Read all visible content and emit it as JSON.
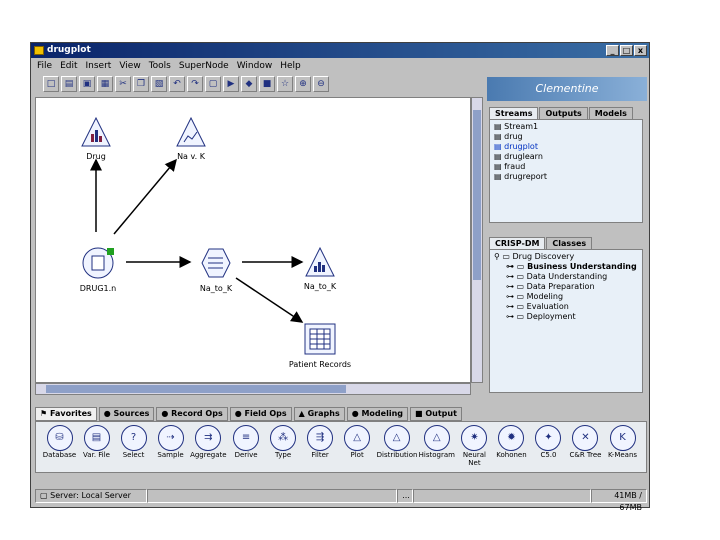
{
  "window": {
    "title": "drugplot",
    "min": "_",
    "max": "□",
    "close": "x"
  },
  "menu": [
    "File",
    "Edit",
    "Insert",
    "View",
    "Tools",
    "SuperNode",
    "Window",
    "Help"
  ],
  "nodes": {
    "drug": "Drug",
    "navk1": "Na v. K",
    "drug1n": "DRUG1.n",
    "na_to_k_derive": "Na_to_K",
    "na_to_k_hist": "Na_to_K",
    "patient_records": "Patient Records"
  },
  "right": {
    "brand": "Clementine",
    "tabs": [
      "Streams",
      "Outputs",
      "Models"
    ],
    "streams": [
      "Stream1",
      "drug",
      "drugplot",
      "druglearn",
      "fraud",
      "drugreport"
    ],
    "project_tabs": [
      "CRISP-DM",
      "Classes"
    ],
    "project": {
      "root": "Drug Discovery",
      "phases": [
        "Business Understanding",
        "Data Understanding",
        "Data Preparation",
        "Modeling",
        "Evaluation",
        "Deployment"
      ]
    }
  },
  "palette": {
    "tabs": [
      "Favorites",
      "Sources",
      "Record Ops",
      "Field Ops",
      "Graphs",
      "Modeling",
      "Output"
    ],
    "items": [
      "Database",
      "Var. File",
      "Select",
      "Sample",
      "Aggregate",
      "Derive",
      "Type",
      "Filter",
      "Plot",
      "Distribution",
      "Histogram",
      "Neural Net",
      "Kohonen",
      "C5.0",
      "C&R Tree",
      "K-Means"
    ]
  },
  "status": {
    "server": "Server: Local Server",
    "ellipsis": "...",
    "memory": "41MB / 67MB"
  }
}
